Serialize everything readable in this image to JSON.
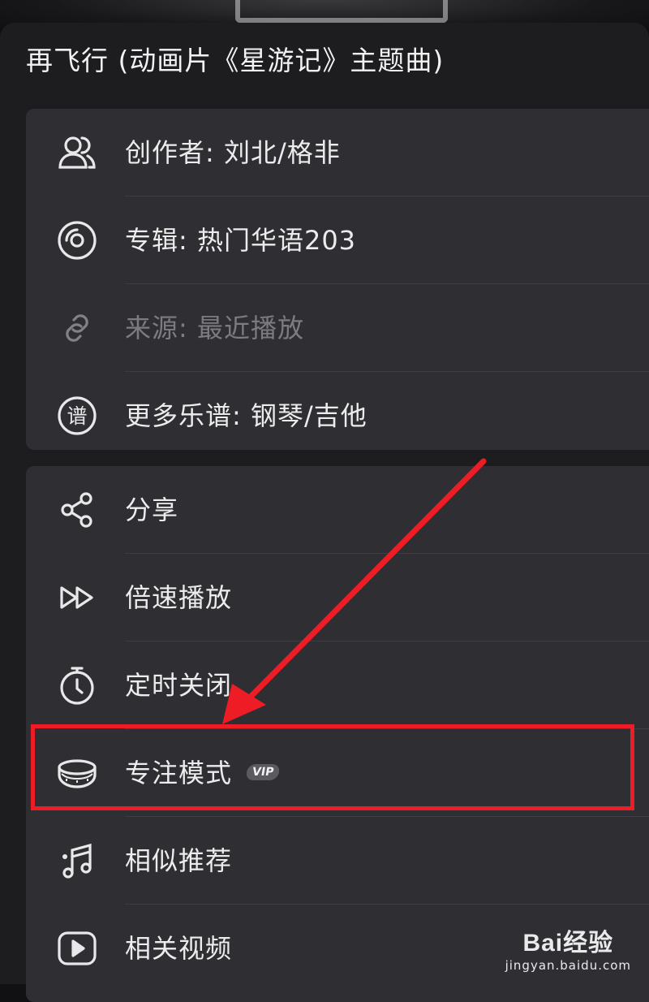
{
  "header": {
    "title": "再飞行 (动画片《星游记》主题曲)"
  },
  "info_section": {
    "items": [
      {
        "label": "创作者: 刘北/格非",
        "icon": "person-icon"
      },
      {
        "label": "专辑:  热门华语203",
        "icon": "album-disc-icon"
      },
      {
        "label": "来源:  最近播放",
        "icon": "link-icon",
        "disabled": true
      },
      {
        "label": "更多乐谱:  钢琴/吉他",
        "icon": "score-icon"
      }
    ]
  },
  "actions_section": {
    "items": [
      {
        "label": "分享",
        "icon": "share-icon"
      },
      {
        "label": "倍速播放",
        "icon": "speed-icon"
      },
      {
        "label": "定时关闭",
        "icon": "timer-icon"
      },
      {
        "label": "专注模式",
        "icon": "focus-drum-icon",
        "badge": "VIP"
      },
      {
        "label": "相似推荐",
        "icon": "music-note-icon"
      },
      {
        "label": "相关视频",
        "icon": "video-play-icon"
      }
    ]
  },
  "annotation": {
    "highlight_color": "#ee1c24"
  },
  "watermark": {
    "logo": "Bai经验",
    "url": "jingyan.baidu.com"
  }
}
